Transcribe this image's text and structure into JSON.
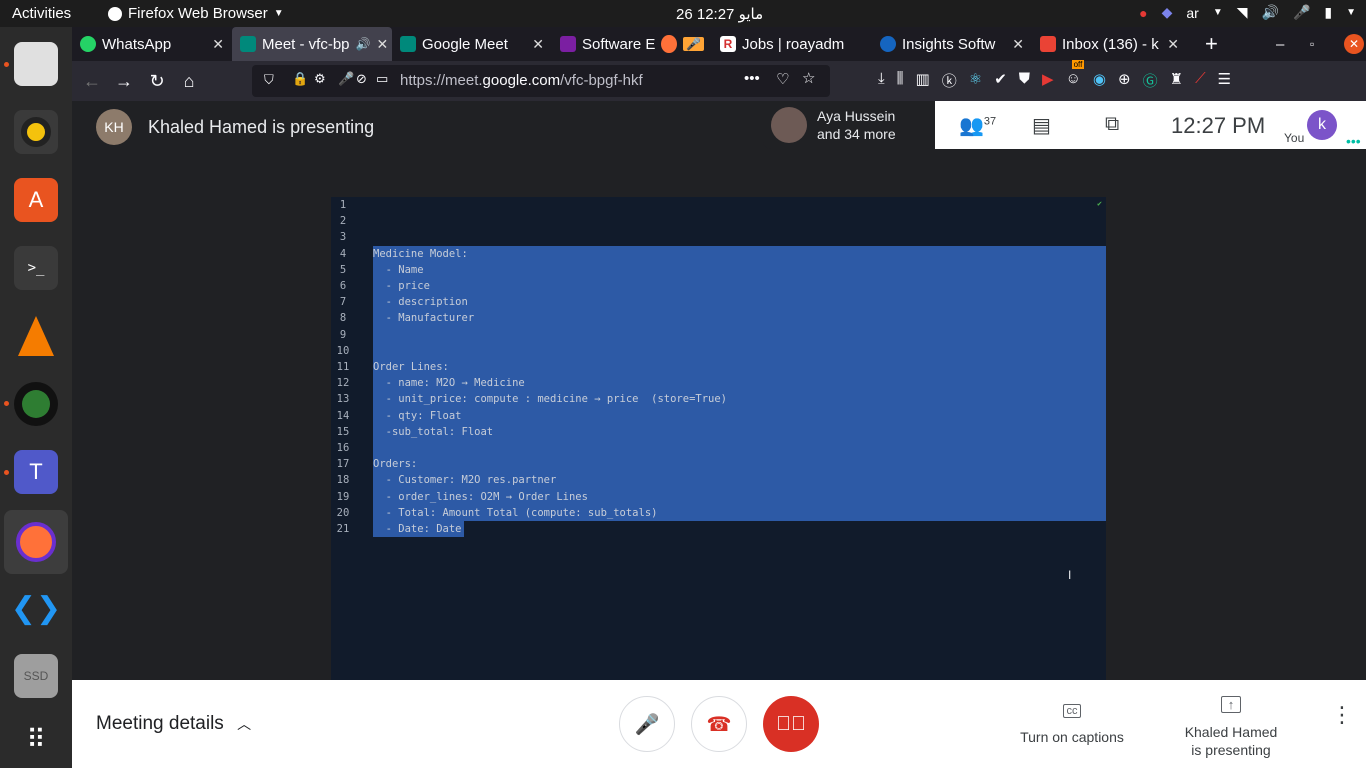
{
  "topbar": {
    "activities": "Activities",
    "app_name": "Firefox Web Browser",
    "clock": "26 مايو  12:27",
    "lang": "ar"
  },
  "tabs": [
    {
      "label": "WhatsApp",
      "color": "#25d366"
    },
    {
      "label": "Meet - vfc-bp",
      "color": "#00897b"
    },
    {
      "label": "Google Meet",
      "color": "#00897b"
    },
    {
      "label": "Software E",
      "color": "#7b1fa2"
    },
    {
      "label": "Jobs | roayadm",
      "color": "#d32f2f"
    },
    {
      "label": "Insights Softw",
      "color": "#1565c0"
    },
    {
      "label": "Inbox (136) - k",
      "color": "#ea4335"
    }
  ],
  "browser": {
    "url_prefix": "https://meet.",
    "url_domain": "google.com",
    "url_path": "/vfc-bpgf-hkf",
    "badge_off": "off"
  },
  "meet": {
    "presenter_text": "Khaled Hamed is presenting",
    "participant_name": "Aya Hussein",
    "participant_more": "and 34 more",
    "people_count": "37",
    "time": "12:27  PM",
    "you_label": "You",
    "you_initial": "k"
  },
  "editor": {
    "lines": [
      {
        "n": "1",
        "t": ""
      },
      {
        "n": "2",
        "t": ""
      },
      {
        "n": "3",
        "t": ""
      },
      {
        "n": "4",
        "t": "Medicine Model:"
      },
      {
        "n": "5",
        "t": "  - Name"
      },
      {
        "n": "6",
        "t": "  - price"
      },
      {
        "n": "7",
        "t": "  - description"
      },
      {
        "n": "8",
        "t": "  - Manufacturer"
      },
      {
        "n": "9",
        "t": ""
      },
      {
        "n": "10",
        "t": ""
      },
      {
        "n": "11",
        "t": "Order Lines:"
      },
      {
        "n": "12",
        "t": "  - name: M2O → Medicine"
      },
      {
        "n": "13",
        "t": "  - unit_price: compute : medicine → price  (store=True)"
      },
      {
        "n": "14",
        "t": "  - qty: Float"
      },
      {
        "n": "15",
        "t": "  -sub_total: Float"
      },
      {
        "n": "16",
        "t": ""
      },
      {
        "n": "17",
        "t": "Orders:"
      },
      {
        "n": "18",
        "t": "  - Customer: M2O res.partner"
      },
      {
        "n": "19",
        "t": "  - order_lines: O2M → Order Lines"
      },
      {
        "n": "20",
        "t": "  - Total: Amount Total (compute: sub_totals)"
      },
      {
        "n": "21",
        "t": "  - Date: Date"
      }
    ],
    "selected_from": 4,
    "selected_to": 21
  },
  "bottom": {
    "meeting_details": "Meeting details",
    "captions_label": "Turn on captions",
    "presenting_label_1": "Khaled Hamed",
    "presenting_label_2": "is presenting"
  }
}
